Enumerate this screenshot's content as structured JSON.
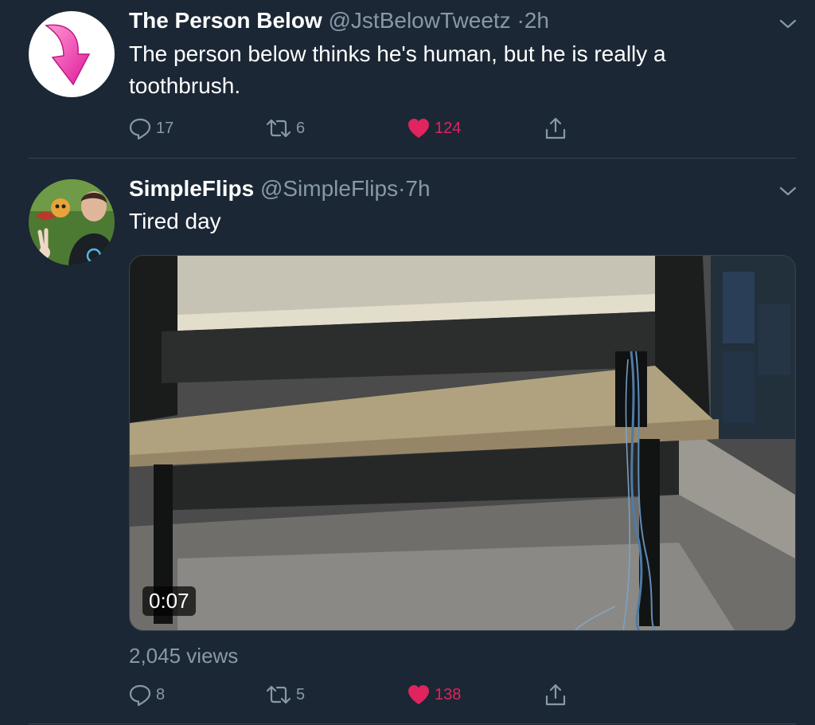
{
  "tweets": [
    {
      "name": "The Person Below",
      "handle": "@JstBelowTweetz",
      "sep": "·",
      "time": "2h",
      "text": "The person below thinks he's human, but he is really a toothbrush.",
      "replies": "17",
      "retweets": "6",
      "likes": "124",
      "liked": true
    },
    {
      "name": "SimpleFlips",
      "handle": "@SimpleFlips",
      "sep": "·",
      "time": "7h",
      "text": "Tired day",
      "video_duration": "0:07",
      "views": "2,045 views",
      "replies": "8",
      "retweets": "5",
      "likes": "138",
      "liked": true
    }
  ],
  "icons": {
    "reply": "reply-icon",
    "retweet": "retweet-icon",
    "like": "heart-icon",
    "share": "share-icon",
    "caret": "chevron-down-icon"
  },
  "colors": {
    "background": "#1b2734",
    "muted": "#8899a6",
    "like": "#e0245e",
    "divider": "#38444d"
  }
}
